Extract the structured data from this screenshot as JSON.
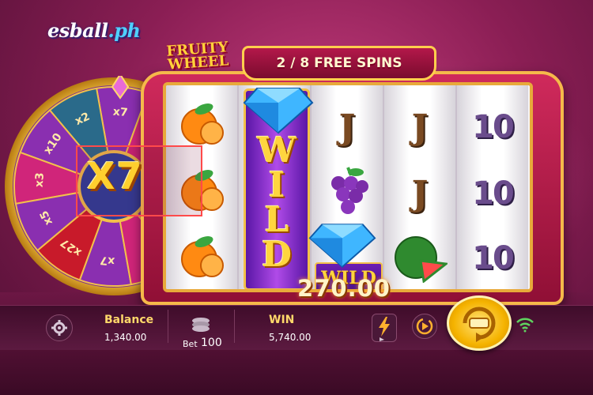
{
  "brand": {
    "logo_text": "esball",
    "logo_suffix": ".ph"
  },
  "game": {
    "title_line1": "FRUITY",
    "title_line2": "WHEEL",
    "free_spins": "2 / 8 FREE SPINS"
  },
  "multiplier": {
    "value": "X7"
  },
  "wheel": {
    "segments": [
      "x7",
      "x2",
      "x10",
      "x3",
      "x5",
      "x27",
      "x7"
    ]
  },
  "reels": {
    "wild_label": "WILD",
    "wild_letters": [
      "W",
      "I",
      "L",
      "D"
    ],
    "j_symbol": "J",
    "ten_symbol": "10"
  },
  "win_amount": "270.00",
  "bottom_bar": {
    "balance_label": "Balance",
    "balance_value": "1,340.00",
    "bet_label": "Bet",
    "bet_value": "100",
    "win_label": "WIN",
    "win_value": "5,740.00"
  },
  "icons": {
    "settings": "gear-icon",
    "bet": "chips-icon",
    "turbo": "lightning-icon",
    "autoplay": "autoplay-icon",
    "spin": "spin-icon",
    "network": "wifi-icon"
  },
  "colors": {
    "accent_gold": "#ffcf2e",
    "frame_red": "#c8234f",
    "wild_purple": "#7a2bd0"
  }
}
